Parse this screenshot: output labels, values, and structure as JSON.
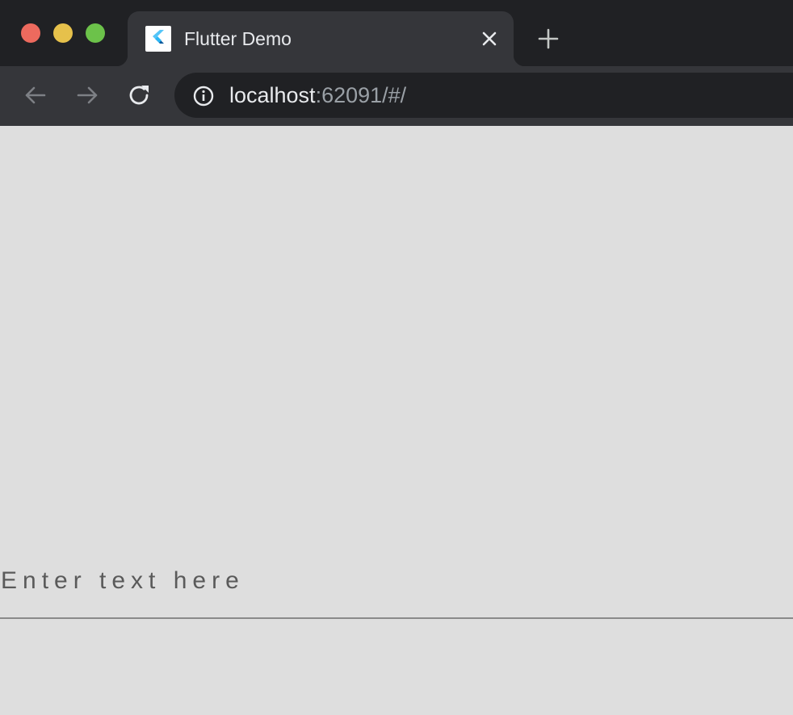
{
  "window": {
    "controls": [
      "close",
      "minimize",
      "maximize"
    ]
  },
  "tab": {
    "title": "Flutter Demo",
    "favicon": "flutter-logo-icon",
    "close_icon": "close-icon"
  },
  "new_tab": {
    "icon": "plus-icon"
  },
  "toolbar": {
    "back_icon": "arrow-left-icon",
    "forward_icon": "arrow-right-icon",
    "reload_icon": "reload-icon",
    "address": {
      "info_icon": "info-icon",
      "host": "localhost",
      "rest": ":62091/#/"
    }
  },
  "page": {
    "text_field": {
      "hint": "Enter text here"
    }
  },
  "colors": {
    "tab_strip": "#202124",
    "toolbar": "#35363a",
    "page_background": "#dedede",
    "hint_text": "#5a5a5a",
    "underline": "#8a8a8a"
  }
}
